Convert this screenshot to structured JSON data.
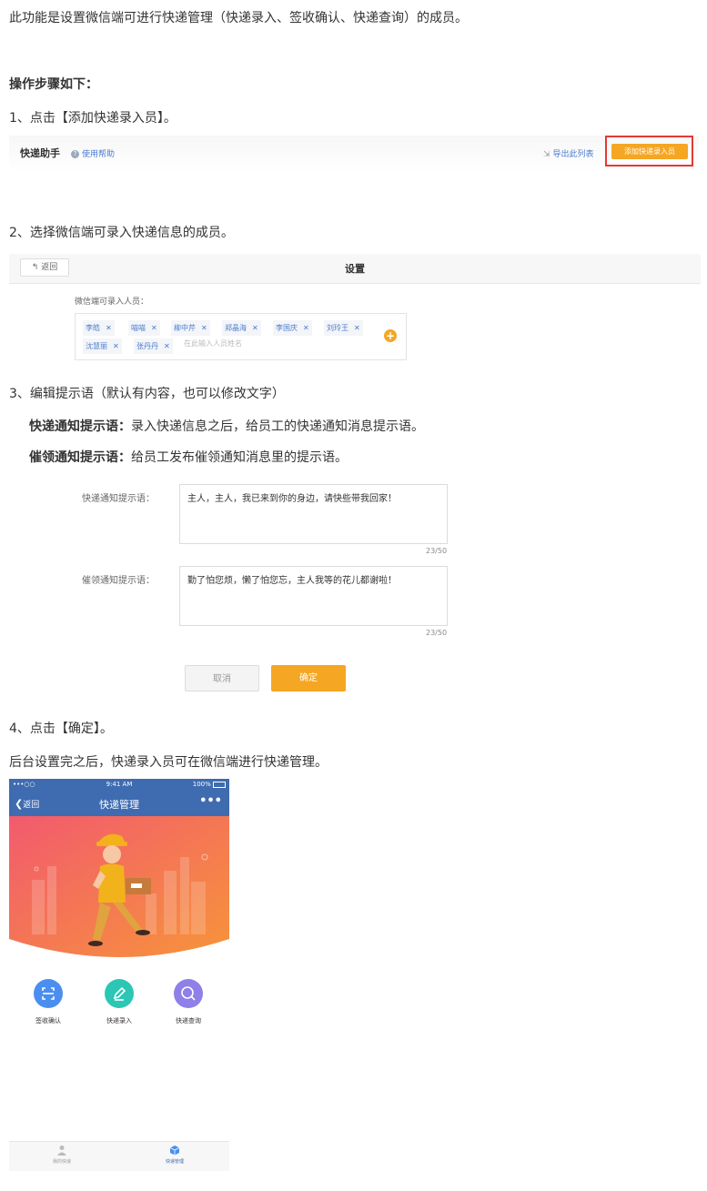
{
  "intro": "此功能是设置微信端可进行快递管理（快递录入、签收确认、快递查询）的成员。",
  "steps_heading": "操作步骤如下：",
  "step1": "1、点击【添加快递录入员】。",
  "toolbar": {
    "title": "快递助手",
    "help": "使用帮助",
    "export": "导出此列表",
    "add_button": "添加快递录入员"
  },
  "step2": "2、选择微信端可录入快递信息的成员。",
  "settings": {
    "back": "返回",
    "title": "设置",
    "member_label": "微信端可录入人员：",
    "members": [
      "李皓",
      "喵喵",
      "柳中芹",
      "郑晶海",
      "李国庆",
      "刘玲王",
      "沈慧丽",
      "张丹丹"
    ],
    "member_placeholder": "在此输入人员姓名"
  },
  "step3": "3、编辑提示语（默认有内容，也可以修改文字）",
  "express_tip": {
    "label": "快递通知提示语：",
    "desc": "录入快递信息之后，给员工的快递通知消息提示语。"
  },
  "claim_tip": {
    "label": "催领通知提示语：",
    "desc": "给员工发布催领通知消息里的提示语。"
  },
  "form": {
    "express_label": "快递通知提示语：",
    "express_value": "主人，主人，我已来到你的身边，请快些带我回家！",
    "express_count": "23/50",
    "claim_label": "催领通知提示语：",
    "claim_value": "勤了怕您烦，懒了怕您忘，主人我等的花儿都谢啦！",
    "claim_count": "23/50",
    "cancel": "取消",
    "confirm": "确定"
  },
  "step4": "4、点击【确定】。",
  "after": "后台设置完之后，快递录入员可在微信端进行快递管理。",
  "phone": {
    "status_left": "•••○○",
    "time": "9:41 AM",
    "battery": "100%",
    "back": "返回",
    "title": "快递管理",
    "more": "•••",
    "apps": [
      {
        "label": "签收确认",
        "color": "#4a8ff0"
      },
      {
        "label": "快递录入",
        "color": "#2cc6b5"
      },
      {
        "label": "快递查询",
        "color": "#8f7fe8"
      }
    ],
    "tabs": [
      "我的快递",
      "快递管理"
    ]
  }
}
